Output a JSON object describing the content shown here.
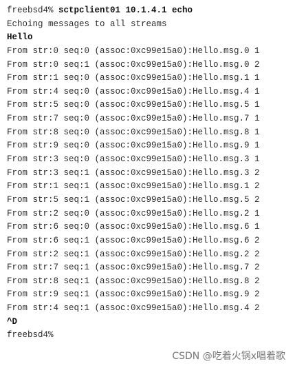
{
  "terminal": {
    "prompt_label": "freebsd4%",
    "command": "sctpclient01 10.1.4.1 echo",
    "echo_notice": "Echoing messages to all streams",
    "input_text": "Hello",
    "output_lines": [
      "From str:0 seq:0 (assoc:0xc99e15a0):Hello.msg.0 1",
      "From str:0 seq:1 (assoc:0xc99e15a0):Hello.msg.0 2",
      "From str:1 seq:0 (assoc:0xc99e15a0):Hello.msg.1 1",
      "From str:4 seq:0 (assoc:0xc99e15a0):Hello.msg.4 1",
      "From str:5 seq:0 (assoc:0xc99e15a0):Hello.msg.5 1",
      "From str:7 seq:0 (assoc:0xc99e15a0):Hello.msg.7 1",
      "From str:8 seq:0 (assoc:0xc99e15a0):Hello.msg.8 1",
      "From str:9 seq:0 (assoc:0xc99e15a0):Hello.msg.9 1",
      "From str:3 seq:0 (assoc:0xc99e15a0):Hello.msg.3 1",
      "From str:3 seq:1 (assoc:0xc99e15a0):Hello.msg.3 2",
      "From str:1 seq:1 (assoc:0xc99e15a0):Hello.msg.1 2",
      "From str:5 seq:1 (assoc:0xc99e15a0):Hello.msg.5 2",
      "From str:2 seq:0 (assoc:0xc99e15a0):Hello.msg.2 1",
      "From str:6 seq:0 (assoc:0xc99e15a0):Hello.msg.6 1",
      "From str:6 seq:1 (assoc:0xc99e15a0):Hello.msg.6 2",
      "From str:2 seq:1 (assoc:0xc99e15a0):Hello.msg.2 2",
      "From str:7 seq:1 (assoc:0xc99e15a0):Hello.msg.7 2",
      "From str:8 seq:1 (assoc:0xc99e15a0):Hello.msg.8 2",
      "From str:9 seq:1 (assoc:0xc99e15a0):Hello.msg.9 2",
      "From str:4 seq:1 (assoc:0xc99e15a0):Hello.msg.4 2"
    ],
    "eof_text": "^D",
    "final_prompt": "freebsd4%"
  },
  "watermark": {
    "text": "CSDN @吃着火锅x唱着歌"
  }
}
